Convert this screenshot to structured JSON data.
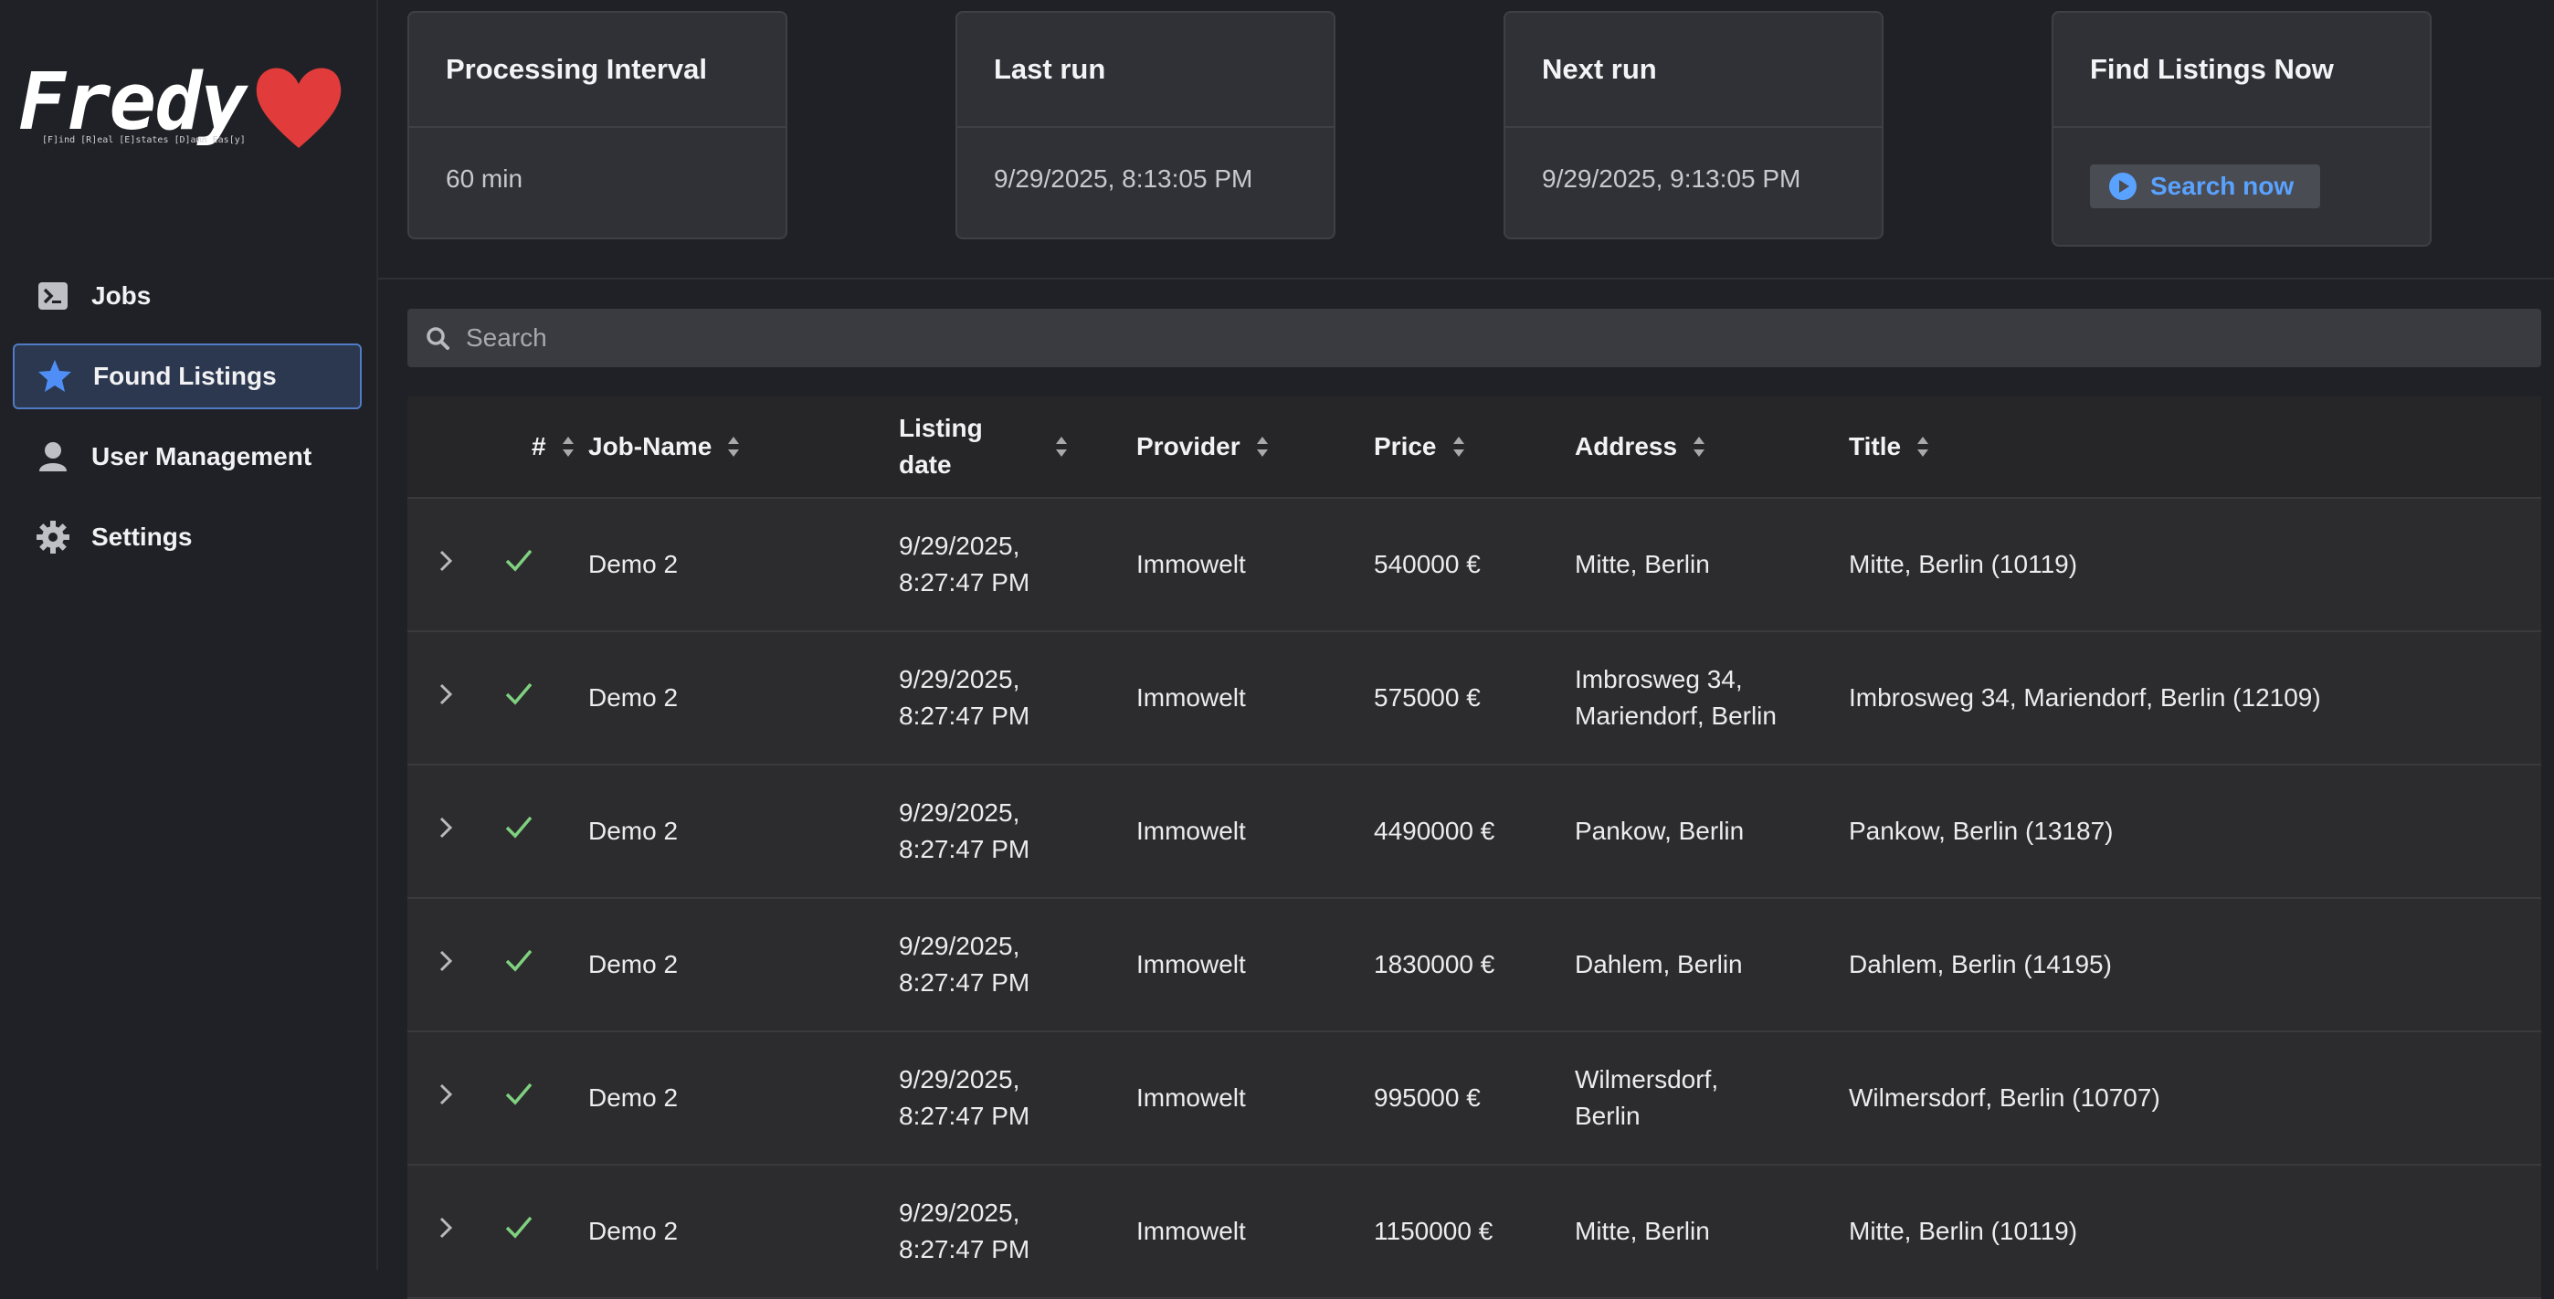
{
  "logo": {
    "name": "Fredy",
    "tagline": "[F]ind [R]eal [E]states [D]amn Eas[y]"
  },
  "nav": [
    {
      "label": "Jobs",
      "icon": "terminal-icon",
      "active": false
    },
    {
      "label": "Found Listings",
      "icon": "star-icon",
      "active": true
    },
    {
      "label": "User Management",
      "icon": "user-icon",
      "active": false
    },
    {
      "label": "Settings",
      "icon": "gear-icon",
      "active": false
    }
  ],
  "cards": {
    "interval": {
      "title": "Processing Interval",
      "value": "60 min"
    },
    "last_run": {
      "title": "Last run",
      "value": "9/29/2025, 8:13:05 PM"
    },
    "next_run": {
      "title": "Next run",
      "value": "9/29/2025, 9:13:05 PM"
    },
    "find": {
      "title": "Find Listings Now",
      "button": "Search now"
    }
  },
  "search": {
    "placeholder": "Search"
  },
  "table": {
    "columns": [
      "#",
      "Job-Name",
      "Listing date",
      "Provider",
      "Price",
      "Address",
      "Title"
    ],
    "rows": [
      {
        "job": "Demo 2",
        "date1": "9/29/2025,",
        "date2": "8:27:47 PM",
        "provider": "Immowelt",
        "price": "540000 €",
        "addr1": "Mitte, Berlin",
        "addr2": "",
        "title": "Mitte, Berlin (10119)"
      },
      {
        "job": "Demo 2",
        "date1": "9/29/2025,",
        "date2": "8:27:47 PM",
        "provider": "Immowelt",
        "price": "575000 €",
        "addr1": "Imbrosweg 34,",
        "addr2": "Mariendorf, Berlin",
        "title": "Imbrosweg 34, Mariendorf, Berlin (12109)"
      },
      {
        "job": "Demo 2",
        "date1": "9/29/2025,",
        "date2": "8:27:47 PM",
        "provider": "Immowelt",
        "price": "4490000 €",
        "addr1": "Pankow, Berlin",
        "addr2": "",
        "title": "Pankow, Berlin (13187)"
      },
      {
        "job": "Demo 2",
        "date1": "9/29/2025,",
        "date2": "8:27:47 PM",
        "provider": "Immowelt",
        "price": "1830000 €",
        "addr1": "Dahlem, Berlin",
        "addr2": "",
        "title": "Dahlem, Berlin (14195)"
      },
      {
        "job": "Demo 2",
        "date1": "9/29/2025,",
        "date2": "8:27:47 PM",
        "provider": "Immowelt",
        "price": "995000 €",
        "addr1": "Wilmersdorf,",
        "addr2": "Berlin",
        "title": "Wilmersdorf, Berlin (10707)"
      },
      {
        "job": "Demo 2",
        "date1": "9/29/2025,",
        "date2": "8:27:47 PM",
        "provider": "Immowelt",
        "price": "1150000 €",
        "addr1": "Mitte, Berlin",
        "addr2": "",
        "title": "Mitte, Berlin (10119)"
      }
    ]
  },
  "colors": {
    "accent": "#4f7cc4",
    "link": "#5aa2ff",
    "check": "#7fd17f",
    "heart": "#e23b3b"
  }
}
